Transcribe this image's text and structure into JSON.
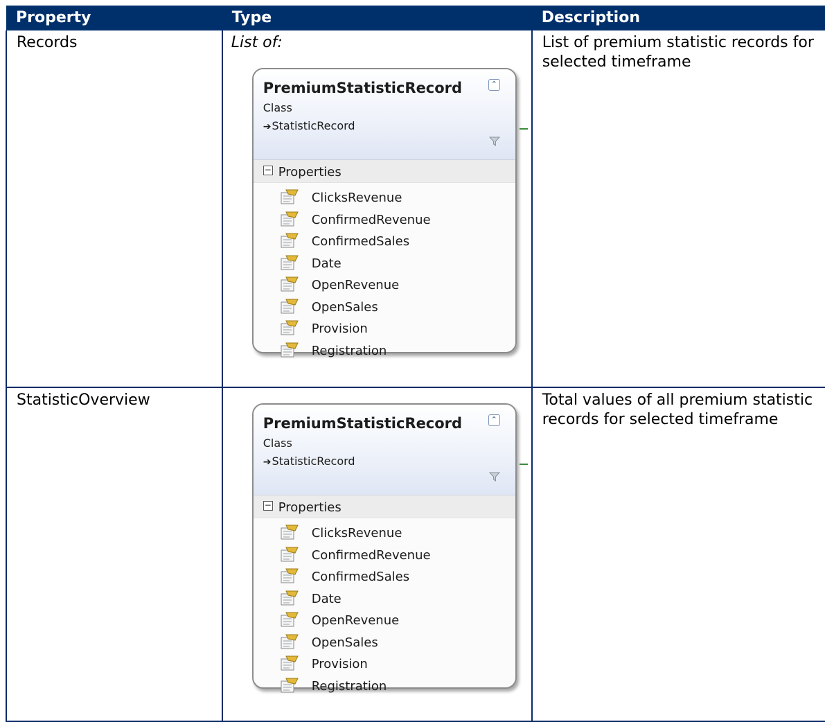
{
  "table": {
    "headers": [
      "Property",
      "Type",
      "Description"
    ],
    "rows": [
      {
        "property": "Records",
        "type_prefix": "List of:",
        "class_box": {
          "name": "PremiumStatisticRecord",
          "kind": "Class",
          "base": "StatisticRecord",
          "section": "Properties",
          "properties": [
            "ClicksRevenue",
            "ConfirmedRevenue",
            "ConfirmedSales",
            "Date",
            "OpenRevenue",
            "OpenSales",
            "Provision",
            "Registration"
          ]
        },
        "description": "List of premium statistic records for selected timeframe"
      },
      {
        "property": "StatisticOverview",
        "type_prefix": "",
        "class_box": {
          "name": "PremiumStatisticRecord",
          "kind": "Class",
          "base": "StatisticRecord",
          "section": "Properties",
          "properties": [
            "ClicksRevenue",
            "ConfirmedRevenue",
            "ConfirmedSales",
            "Date",
            "OpenRevenue",
            "OpenSales",
            "Provision",
            "Registration"
          ]
        },
        "description": "Total values of all premium statistic records for selected timeframe"
      }
    ]
  },
  "colors": {
    "header_bg": "#00306b",
    "header_text": "#ffffff",
    "grid": "#0a2a66"
  },
  "icons": {
    "collapse": "double-chevron-up-icon",
    "filter": "filter-funnel-icon",
    "property": "property-icon",
    "section_toggle": "minus-box-icon",
    "base_arrow": "inheritance-arrow-icon"
  }
}
